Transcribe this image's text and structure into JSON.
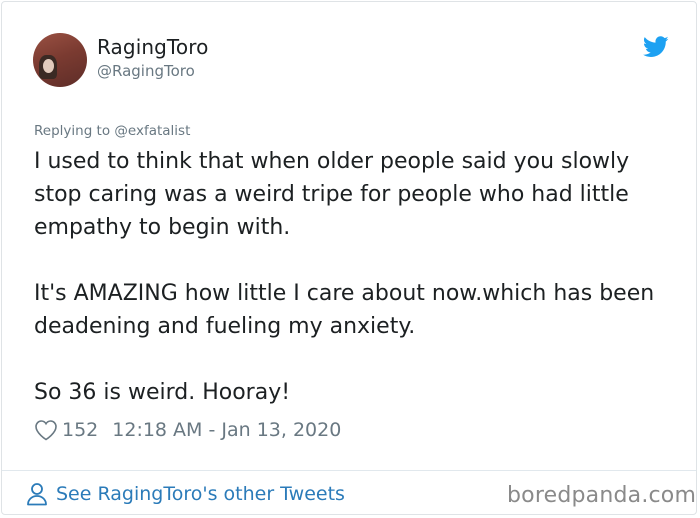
{
  "tweet": {
    "author": {
      "display_name": "RagingToro",
      "handle": "@RagingToro",
      "avatar": "avatar-photo"
    },
    "platform_icon": "twitter-bird-icon",
    "brand_color": "#1da1f2",
    "replying_to": "Replying to @exfatalist",
    "paragraphs": [
      "I used to think that when older people said you slowly stop caring was a weird tripe for people who had little empathy to begin with.",
      "It's AMAZING how little I care about now.which has been deadening and fueling my anxiety.",
      "So 36 is weird. Hooray!"
    ],
    "likes_count": "152",
    "timestamp": "12:18 AM - Jan 13, 2020",
    "like_icon": "heart-outline-icon"
  },
  "footer": {
    "other_tweets_link": "See RagingToro's other Tweets",
    "link_icon": "person-outline-icon",
    "link_color": "#2b7bb9"
  },
  "watermark": "boredpanda.com"
}
